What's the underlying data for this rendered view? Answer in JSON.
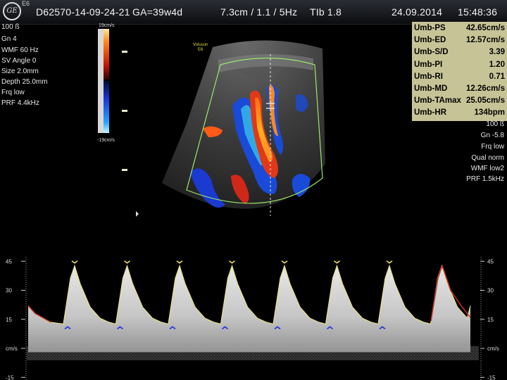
{
  "topbar": {
    "logo": "GE",
    "probe_label": "E6",
    "patient_id": "D62570-14-09-24-21",
    "gestational_age": "GA=39w4d",
    "depth_settings": "7.3cm / 1.1 / 5Hz",
    "thermal_index": "TIb 1.8",
    "date": "24.09.2014",
    "time": "15:48:36"
  },
  "left_params": [
    "100 ß",
    "Gn  4",
    "WMF 60 Hz",
    "SV Angle  0",
    "Size  2.0mm",
    "Depth 25.0mm",
    "Frq low",
    "PRF  4.4kHz"
  ],
  "colorbar": {
    "top_label": "19cm/s",
    "bottom_label": "-19cm/s"
  },
  "voluson": {
    "line1": "Voluson",
    "line2": "E6"
  },
  "measurements": [
    {
      "label": "Umb-PS",
      "value": "42.65cm/s"
    },
    {
      "label": "Umb-ED",
      "value": "12.57cm/s"
    },
    {
      "label": "Umb-S/D",
      "value": "3.39"
    },
    {
      "label": "Umb-PI",
      "value": "1.20"
    },
    {
      "label": "Umb-RI",
      "value": "0.71"
    },
    {
      "label": "Umb-MD",
      "value": "12.26cm/s"
    },
    {
      "label": "Umb-TAmax",
      "value": "25.05cm/s"
    },
    {
      "label": "Umb-HR",
      "value": "134bpm"
    }
  ],
  "right_params": [
    "100 ß",
    "Gn -5.8",
    "Frq low",
    "Qual norm",
    "WMF low2",
    "PRF  1.5kHz"
  ],
  "spectral": {
    "scale_ticks": [
      {
        "value": 45,
        "label": "45"
      },
      {
        "value": 30,
        "label": "30"
      },
      {
        "value": 15,
        "label": "15"
      },
      {
        "value": 0,
        "label": "cm/s"
      },
      {
        "value": -15,
        "label": "-15"
      }
    ],
    "cycles": 8
  },
  "colors": {
    "trace_yellow": "#e6e08a",
    "trace_red": "#c8302a",
    "marker_blue": "#2a3cd8",
    "marker_yellow": "#f0e060",
    "roi_green": "#9be86c",
    "meas_bg": "#c6c497"
  }
}
